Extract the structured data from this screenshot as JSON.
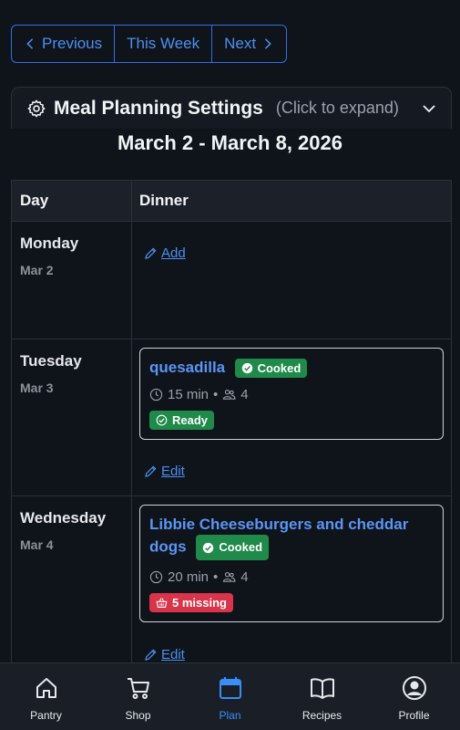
{
  "week_nav": {
    "previous": "Previous",
    "this_week": "This Week",
    "next": "Next"
  },
  "settings": {
    "title": "Meal Planning Settings",
    "hint": "(Click to expand)"
  },
  "week_title": "March 2 - March 8, 2026",
  "table": {
    "headers": {
      "day": "Day",
      "dinner": "Dinner"
    },
    "rows": [
      {
        "day": "Monday",
        "date": "Mar 2",
        "action": "Add"
      },
      {
        "day": "Tuesday",
        "date": "Mar 3",
        "meal": {
          "title": "quesadilla",
          "cooked": "Cooked",
          "time": "15 min",
          "servings": "4",
          "status": "Ready"
        },
        "action": "Edit"
      },
      {
        "day": "Wednesday",
        "date": "Mar 4",
        "meal": {
          "title_line1": "Libbie Cheeseburgers and cheddar",
          "title_line2": "dogs",
          "cooked": "Cooked",
          "time": "20 min",
          "servings": "4",
          "status": "5 missing"
        },
        "action": "Edit"
      }
    ]
  },
  "meta_separator": "•",
  "bottom_nav": [
    {
      "label": "Pantry",
      "icon": "home-icon"
    },
    {
      "label": "Shop",
      "icon": "cart-icon"
    },
    {
      "label": "Plan",
      "icon": "calendar-icon",
      "active": true
    },
    {
      "label": "Recipes",
      "icon": "book-icon"
    },
    {
      "label": "Profile",
      "icon": "user-icon"
    }
  ],
  "colors": {
    "background": "#0f131a",
    "accent": "#4d8ff0",
    "success": "#1f8a4a",
    "danger": "#d9344a",
    "active_nav": "#3a8ef6"
  }
}
